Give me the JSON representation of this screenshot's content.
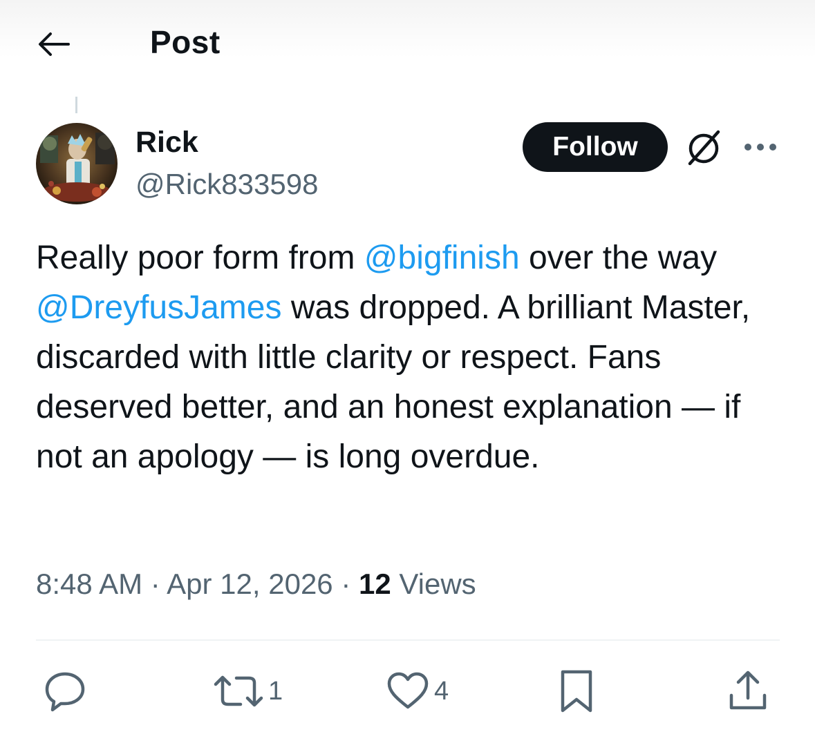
{
  "header": {
    "title": "Post",
    "back_icon": "arrow-left-icon"
  },
  "author": {
    "display_name": "Rick",
    "handle": "@Rick833598",
    "follow_label": "Follow",
    "avatar_icon": "avatar-image"
  },
  "tweet": {
    "segments": [
      {
        "text": "Really poor form from ",
        "mention": false
      },
      {
        "text": "@bigfinish",
        "mention": true
      },
      {
        "text": " over the way ",
        "mention": false
      },
      {
        "text": "@DreyfusJames",
        "mention": true
      },
      {
        "text": " was dropped. A brilliant Master, discarded with little clarity or respect. Fans deserved better, and an honest explanation — if not an apology — is long overdue.",
        "mention": false
      }
    ]
  },
  "meta": {
    "time": "8:48 AM",
    "separator": "·",
    "date": "Apr 12, 2026",
    "views_count": "12",
    "views_label": "Views"
  },
  "actions": {
    "reply": {
      "icon": "reply-icon",
      "count": ""
    },
    "repost": {
      "icon": "repost-icon",
      "count": "1"
    },
    "like": {
      "icon": "heart-icon",
      "count": "4"
    },
    "bookmark": {
      "icon": "bookmark-icon",
      "count": ""
    },
    "share": {
      "icon": "share-icon",
      "count": ""
    }
  },
  "colors": {
    "text": "#0f1419",
    "secondary": "#536471",
    "link": "#1d9bf0",
    "follow_bg": "#0f1419",
    "divider": "#eff3f4"
  }
}
